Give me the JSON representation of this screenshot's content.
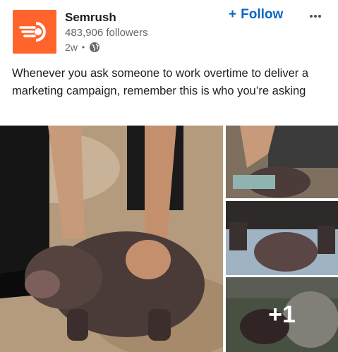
{
  "company": {
    "name": "Semrush",
    "followers": "483,906 followers",
    "time": "2w",
    "separator": "•"
  },
  "actions": {
    "follow_label": "Follow",
    "follow_icon": "+",
    "more_icon": "more-icon"
  },
  "post": {
    "text": "Whenever you ask someone to work overtime to deliver a marketing campaign, remember this is who you’re asking"
  },
  "media": {
    "extra_count": "+1"
  },
  "colors": {
    "brand": "#ff642d",
    "follow": "#0a66c2",
    "muted": "#666666"
  }
}
